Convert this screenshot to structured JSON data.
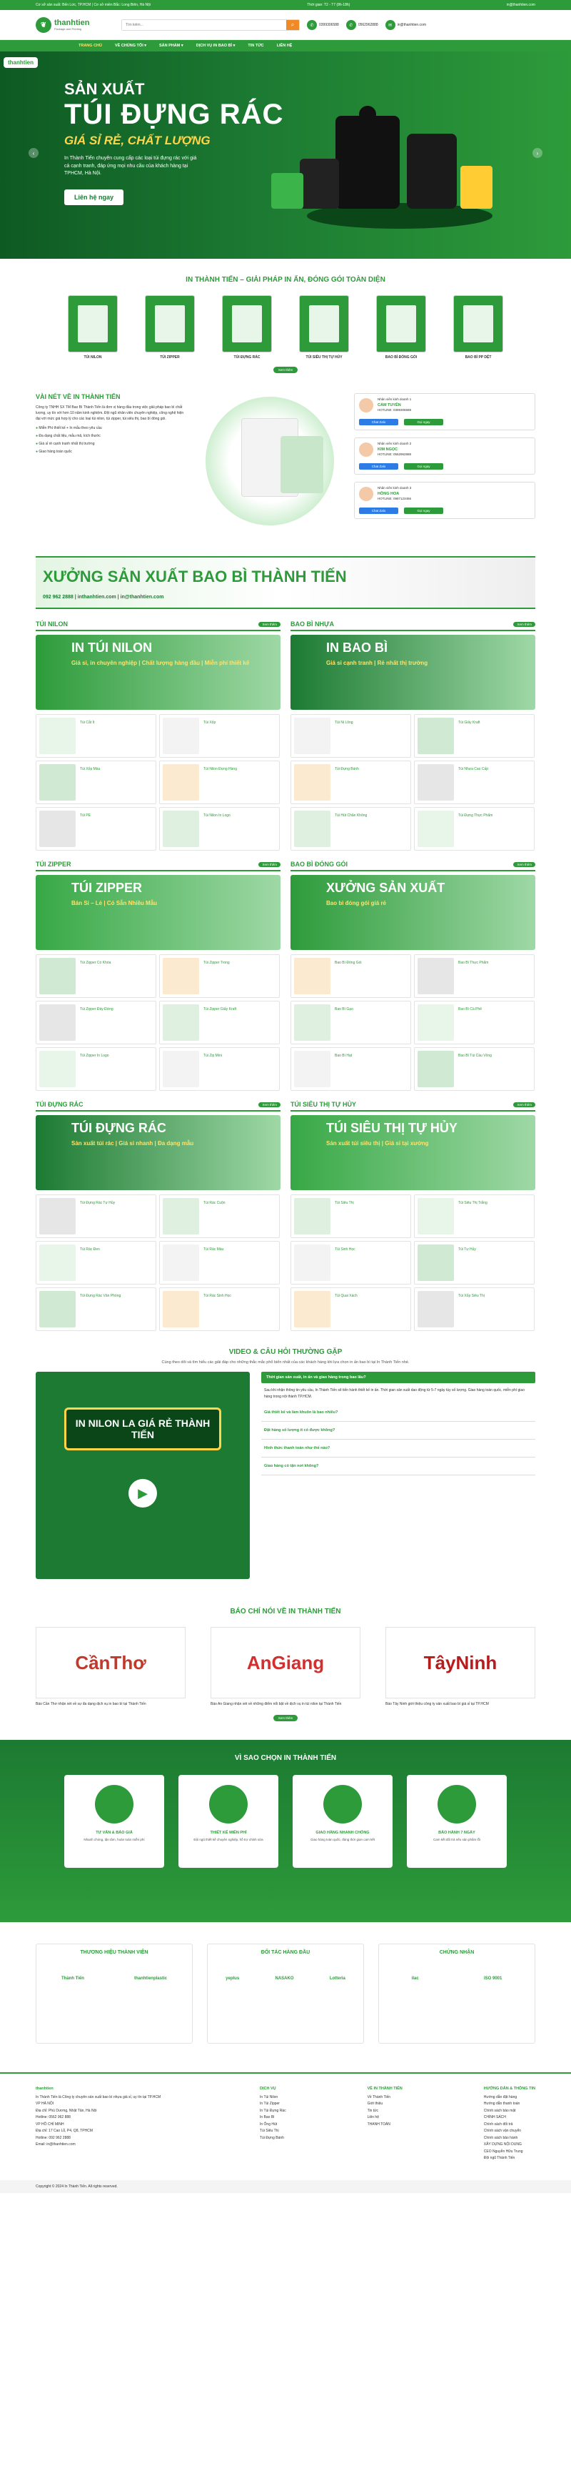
{
  "topbar": {
    "left": "Cơ sở sản xuất: Bến Lức, TP.HCM | Cơ sở miền Bắc: Long Biên, Hà Nội",
    "mid": "Thời gian: T2 - T7 (8h-18h)",
    "right": "in@thanhtien.com"
  },
  "header": {
    "brand": "thanhtien",
    "tagline": "Package and Printing",
    "search_placeholder": "Tìm kiếm...",
    "hotline1": "0399306588",
    "hotline2": "0562962888"
  },
  "nav": [
    "TRANG CHỦ",
    "VỀ CHÚNG TÔI ▾",
    "SẢN PHẨM ▾",
    "DỊCH VỤ IN BAO BÌ ▾",
    "TIN TỨC",
    "LIÊN HỆ"
  ],
  "hero": {
    "logo": "thanhtien",
    "t1": "SẢN XUẤT",
    "t2": "TÚI ĐỰNG RÁC",
    "t3": "GIÁ SỈ RẺ, CHẤT LƯỢNG",
    "desc": "In Thành Tiến chuyên cung cấp các loại túi đựng rác với giá cả cạnh tranh, đáp ứng mọi nhu cầu của khách hàng tại TPHCM, Hà Nội.",
    "btn": "Liên hệ ngay"
  },
  "cats_title": "IN THÀNH TIẾN – GIẢI PHÁP IN ẤN, ĐÓNG GÓI TOÀN DIỆN",
  "cats": [
    "TÚI NILON",
    "TÚI ZIPPER",
    "TÚI ĐỰNG RÁC",
    "TÚI SIÊU THỊ TỰ HỦY",
    "BAO BÌ ĐÓNG GÓI",
    "BAO BÌ PP DỆT"
  ],
  "view_more": "Xem thêm",
  "about": {
    "title": "VÀI NÉT VỀ IN THÀNH TIẾN",
    "p": "Công ty TNHH SX TM Bao Bì Thành Tiến là đơn vị hàng đầu trong việc giải pháp bao bì chất lượng, uy tín với hơn 10 năm kinh nghiệm. Đội ngũ nhân viên chuyên nghiệp, công nghệ hiện đại với mức giá hợp lý cho các loại túi nilon, túi zipper, túi siêu thị, bao bì đóng gói.",
    "list": [
      "Miễn Phí thiết kế + In mẫu theo yêu cầu",
      "Đa dạng chất liệu, mẫu mã, kích thước",
      "Giá sỉ rẻ cạnh tranh nhất thị trường",
      "Giao hàng toàn quốc"
    ]
  },
  "staff": [
    {
      "role": "Nhân viên kinh doanh 1",
      "name": "CẨM TUYÊN",
      "phone": "HOTLINE: 0399306588"
    },
    {
      "role": "Nhân viên kinh doanh 2",
      "name": "KIM NGỌC",
      "phone": "HOTLINE: 0562962888"
    },
    {
      "role": "Nhân viên kinh doanh 3",
      "name": "HỒNG HOA",
      "phone": "HOTLINE: 0987123456"
    }
  ],
  "staff_btn": {
    "zalo": "Chat Zalo",
    "call": "Gọi ngay"
  },
  "banner": {
    "t": "XƯỞNG SẢN XUẤT BAO BÌ THÀNH TIẾN",
    "s": "092 962 2888 | inthanhtien.com | in@thanhtien.com"
  },
  "blocks": [
    {
      "title": "TÚI NILON",
      "bt": "IN TÚI NILON",
      "bs": "Giá sỉ, in chuyên nghiệp | Chất lượng hàng đầu | Miễn phí thiết kế",
      "items": [
        "Túi Cắt Ít",
        "Túi Xốp",
        "Túi Xốp Màu",
        "Túi Nilon Đựng Hàng",
        "Túi PE",
        "Túi Nilon In Logo"
      ]
    },
    {
      "title": "BAO BÌ NHỰA",
      "bt": "IN BAO BÌ",
      "bs": "Giá sỉ cạnh tranh | Rẻ nhất thị trường",
      "items": [
        "Túi Ni Lông",
        "Túi Giấy Kraft",
        "Túi Đựng Bánh",
        "Túi Nhựa Cao Cấp",
        "Túi Hút Chân Không",
        "Túi Đựng Thực Phẩm"
      ]
    },
    {
      "title": "TÚI ZIPPER",
      "bt": "TÚI ZIPPER",
      "bs": "Bán Sỉ – Lẻ | Có Sẵn Nhiều Mẫu",
      "items": [
        "Túi Zipper Có Khóa",
        "Túi Zipper Trong",
        "Túi Zipper Đáy Đứng",
        "Túi Zipper Giấy Kraft",
        "Túi Zipper In Logo",
        "Túi Zip Mini"
      ]
    },
    {
      "title": "BAO BÌ ĐÓNG GÓI",
      "bt": "XƯỞNG SẢN XUẤT",
      "bs": "Bao bì đóng gói giá rẻ",
      "items": [
        "Bao Bì Đóng Gói",
        "Bao Bì Thực Phẩm",
        "Bao Bì Gạo",
        "Bao Bì Cà Phê",
        "Bao Bì Hạt",
        "Bao Bì Túi Cầu Vồng"
      ]
    },
    {
      "title": "TÚI ĐỰNG RÁC",
      "bt": "TÚI ĐỰNG RÁC",
      "bs": "Sản xuất túi rác | Giá sỉ nhanh | Đa dạng mẫu",
      "items": [
        "Túi Đựng Rác Tự Hủy",
        "Túi Rác Cuộn",
        "Túi Rác Đen",
        "Túi Rác Màu",
        "Túi Đựng Rác Văn Phòng",
        "Túi Rác Sinh Học"
      ]
    },
    {
      "title": "TÚI SIÊU THỊ TỰ HỦY",
      "bt": "TÚI SIÊU THỊ TỰ HỦY",
      "bs": "Sản xuất túi siêu thị | Giá sỉ tại xưởng",
      "items": [
        "Túi Siêu Thị",
        "Túi Siêu Thị Trắng",
        "Túi Sinh Học",
        "Túi Tự Hủy",
        "Túi Quai Xách",
        "Túi Xốp Siêu Thị"
      ]
    }
  ],
  "video": {
    "title": "VIDEO & CÂU HỎI THƯỜNG GẶP",
    "desc": "Cùng theo dõi và tìm hiểu các giải đáp cho những thắc mắc phổ biến nhất của các khách hàng khi lựa chọn in ấn bao bì tại In Thành Tiến nhé.",
    "video_label": "IN NILON LA GIÁ RẺ THÀNH TIẾN",
    "q1": "Thời gian sản xuất, in ấn và giao hàng trong bao lâu?",
    "a1": "Sau khi nhận thông tin yêu cầu, In Thành Tiến sẽ tiến hành thiết kế in ấn. Thời gian sản xuất dao động từ 5-7 ngày tùy số lượng. Giao hàng toàn quốc, miễn phí giao hàng trong nội thành TP.HCM.",
    "faqs": [
      "Giá thiết kế và làm khuôn là bao nhiêu?",
      "Đặt hàng số lượng ít có được không?",
      "Hình thức thanh toán như thế nào?",
      "Giao hàng có tận nơi không?"
    ]
  },
  "press": {
    "title": "BÁO CHÍ NÓI VỀ IN THÀNH TIẾN",
    "items": [
      {
        "name": "CầnThơ",
        "text": "Báo Cần Thơ nhận xét về sự đa dạng dịch vụ in bao bì tại Thành Tiến"
      },
      {
        "name": "AnGiang",
        "text": "Báo An Giang nhận xét về những điểm nổi bật về dịch vụ in túi nilon tại Thành Tiến"
      },
      {
        "name": "TâyNinh",
        "text": "Báo Tây Ninh giới thiệu công ty sản xuất bao bì giá sỉ tại TP.HCM"
      }
    ]
  },
  "why": {
    "title": "VÌ SAO CHỌN IN THÀNH TIẾN",
    "items": [
      {
        "t": "TƯ VẤN & BÁO GIÁ",
        "d": "Nhanh chóng, tận tâm, hoàn toàn miễn phí"
      },
      {
        "t": "THIẾT KẾ MIỄN PHÍ",
        "d": "Đội ngũ thiết kế chuyên nghiệp, hỗ trợ chỉnh sửa"
      },
      {
        "t": "GIAO HÀNG NHANH CHÓNG",
        "d": "Giao hàng toàn quốc, đúng thời gian cam kết"
      },
      {
        "t": "BẢO HÀNH 7 NGÀY",
        "d": "Cam kết đổi trả nếu sản phẩm lỗi"
      }
    ]
  },
  "partners": [
    {
      "t": "THƯƠNG HIỆU THÀNH VIÊN",
      "logos": [
        "Thành Tiến",
        "thanhtienplastic"
      ]
    },
    {
      "t": "ĐỐI TÁC HÀNG ĐẦU",
      "logos": [
        "yeplus",
        "NASAKO",
        "Lotteria"
      ]
    },
    {
      "t": "CHỨNG NHẬN",
      "logos": [
        "ilac",
        "ISO 9001"
      ]
    }
  ],
  "footer": {
    "col1": {
      "t": "thanhtien",
      "l": [
        "In Thành Tiến là Công ty chuyên sản xuất bao bì nhựa giá sỉ, uy tín tại TP.HCM",
        "VP HÀ NỘI",
        "Địa chỉ: Phú Dương, Nhật Tân, Hà Nội",
        "Hotline: 0562 962 888",
        "VP HỒ CHÍ MINH",
        "Địa chỉ: 17 Cao Lỗ, P4, Q8, TPHCM",
        "Hotline: 092 962 2888",
        "Email: in@thanhtien.com"
      ]
    },
    "col2": {
      "t": "DỊCH VỤ",
      "l": [
        "In Túi Nilon",
        "In Túi Zipper",
        "In Túi Đựng Rác",
        "In Bao Bì",
        "In Ống Hút",
        "Túi Siêu Thị",
        "Túi Đựng Bánh"
      ]
    },
    "col3": {
      "t": "VỀ IN THÀNH TIẾN",
      "l": [
        "Về Thành Tiến",
        "Giới thiệu",
        "Tin tức",
        "Liên hệ",
        "THANH TOÁN"
      ]
    },
    "col4": {
      "t": "HƯỚNG DẪN & THÔNG TIN",
      "l": [
        "Hướng dẫn đặt hàng",
        "Hướng dẫn thanh toán",
        "Chính sách bảo mật",
        "CHÍNH SÁCH",
        "Chính sách đổi trả",
        "Chính sách vận chuyển",
        "Chính sách bảo hành",
        "XÂY DỰNG NỘI DUNG",
        "CEO Nguyễn Hữu Trung",
        "Đội ngũ Thành Tiến"
      ]
    },
    "copy": "Copyright © 2024 In Thành Tiến. All rights reserved."
  }
}
